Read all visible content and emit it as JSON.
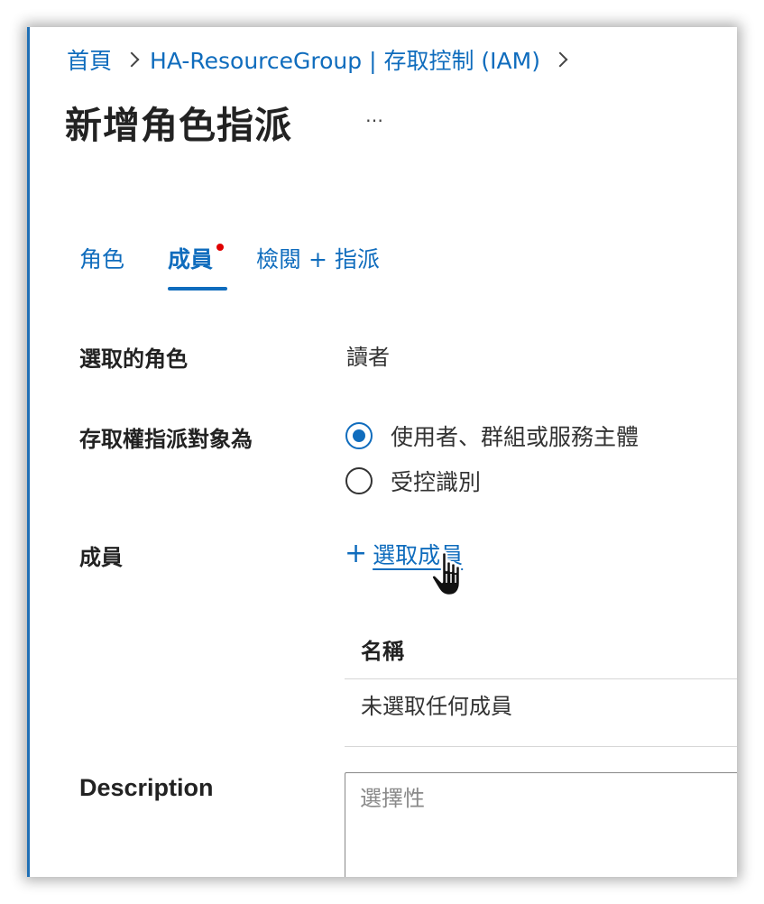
{
  "breadcrumb": {
    "home": "首頁",
    "resource": "HA-ResourceGroup | 存取控制 (IAM)"
  },
  "page": {
    "title": "新增角色指派",
    "more": "…"
  },
  "tabs": [
    {
      "label": "角色"
    },
    {
      "label": "成員",
      "active": true,
      "has_error_dot": true
    },
    {
      "label": "檢閱 + 指派"
    }
  ],
  "form": {
    "selected_role_label": "選取的角色",
    "selected_role_value": "讀者",
    "assign_access_label": "存取權指派對象為",
    "assign_options": [
      {
        "label": "使用者、群組或服務主體",
        "checked": true
      },
      {
        "label": "受控識別",
        "checked": false
      }
    ],
    "members_label": "成員",
    "select_members": "選取成員",
    "table": {
      "header_name": "名稱",
      "empty_text": "未選取任何成員"
    },
    "description_label": "Description",
    "description_placeholder": "選擇性"
  },
  "colors": {
    "accent": "#0f6cbd",
    "error_dot": "#e00000"
  }
}
